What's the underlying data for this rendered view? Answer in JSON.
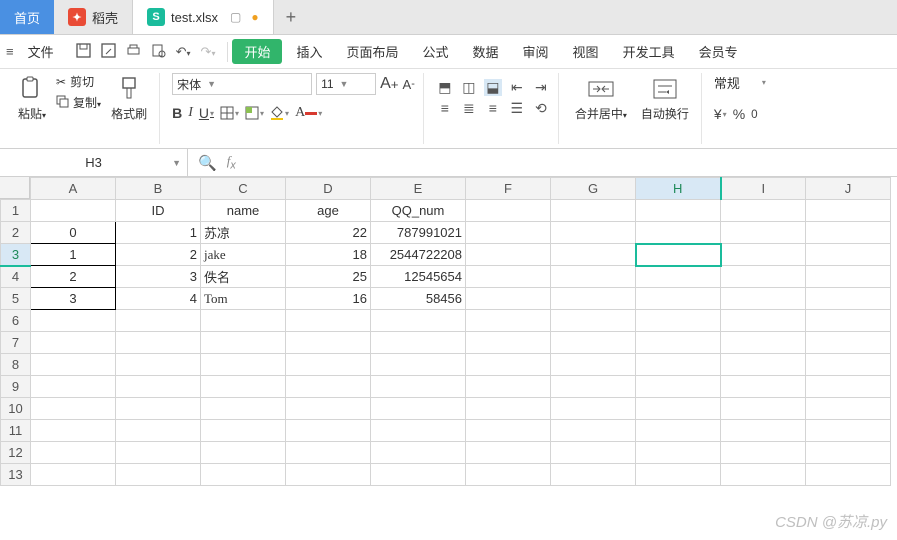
{
  "tabs": {
    "home": "首页",
    "docer": "稻壳",
    "file": "test.xlsx"
  },
  "menu": {
    "hamburger": "≡",
    "file": "文件",
    "start": "开始",
    "insert": "插入",
    "page_layout": "页面布局",
    "formulas": "公式",
    "data": "数据",
    "review": "审阅",
    "view": "视图",
    "dev_tools": "开发工具",
    "member": "会员专"
  },
  "ribbon": {
    "paste": "粘贴",
    "cut": "剪切",
    "copy": "复制",
    "format_painter": "格式刷",
    "font_name": "宋体",
    "font_size": "11",
    "merge_center": "合并居中",
    "wrap_text": "自动换行",
    "number_format": "常规"
  },
  "cell_ref": "H3",
  "columns": [
    "A",
    "B",
    "C",
    "D",
    "E",
    "F",
    "G",
    "H",
    "I",
    "J"
  ],
  "rows": [
    "1",
    "2",
    "3",
    "4",
    "5",
    "6",
    "7",
    "8",
    "9",
    "10",
    "11",
    "12",
    "13"
  ],
  "selected": {
    "col": "H",
    "row": "3"
  },
  "headers": {
    "b": "ID",
    "c": "name",
    "d": "age",
    "e": "QQ_num"
  },
  "data": [
    {
      "idx": "0",
      "id": "1",
      "name": "苏凉",
      "age": "22",
      "qq": "787991021"
    },
    {
      "idx": "1",
      "id": "2",
      "name": "jake",
      "age": "18",
      "qq": "2544722208"
    },
    {
      "idx": "2",
      "id": "3",
      "name": "佚名",
      "age": "25",
      "qq": "12545654"
    },
    {
      "idx": "3",
      "id": "4",
      "name": "Tom",
      "age": "16",
      "qq": "58456"
    }
  ],
  "watermark": "CSDN @苏凉.py"
}
